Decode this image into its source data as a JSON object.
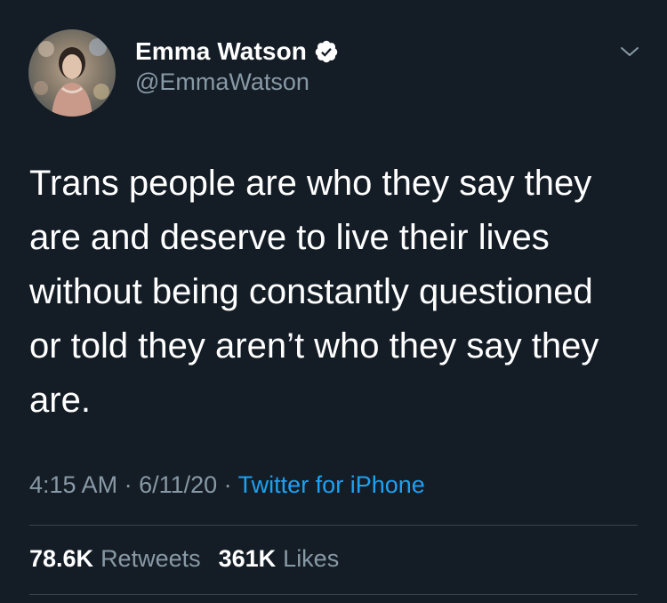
{
  "author": {
    "display_name": "Emma Watson",
    "handle": "@EmmaWatson",
    "verified": true
  },
  "icons": {
    "verified": "verified-badge-icon",
    "menu": "chevron-down-icon"
  },
  "tweet": {
    "text": "Trans people are who they say they\nare and deserve to live their lives\nwithout being constantly questioned\nor told they aren’t who they say they\nare."
  },
  "meta": {
    "time": "4:15 AM",
    "separator": " · ",
    "date": "6/11/20",
    "source": "Twitter for iPhone"
  },
  "stats": {
    "retweets_count": "78.6K",
    "retweets_label": "Retweets",
    "likes_count": "361K",
    "likes_label": "Likes"
  },
  "colors": {
    "background": "#141d26",
    "secondary_text": "#8899a6",
    "link": "#1da1f2",
    "divider": "#38444d"
  }
}
